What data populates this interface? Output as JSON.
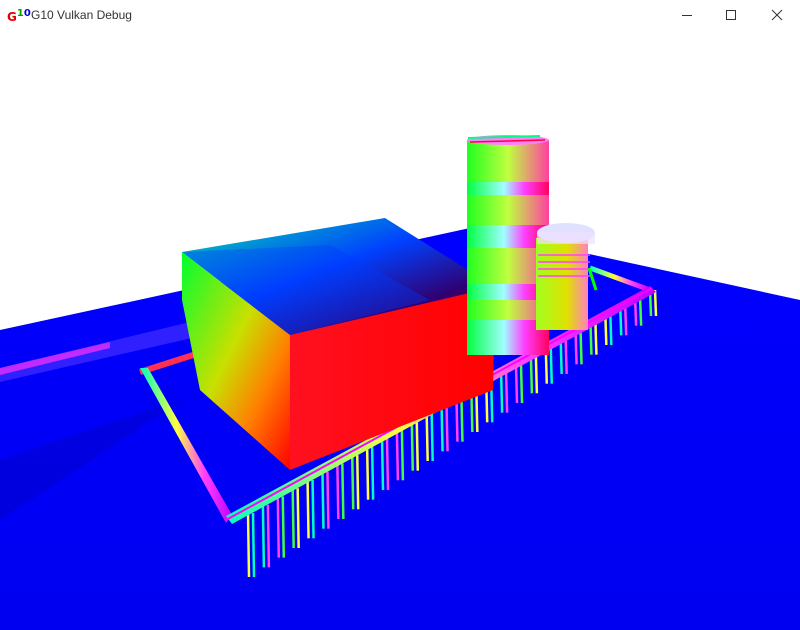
{
  "window": {
    "title": "G10 Vulkan Debug",
    "app_icon_letters": [
      "G",
      "1",
      "0"
    ],
    "app_icon_colors": [
      "#e00000",
      "#00a000",
      "#0000e0"
    ],
    "controls": {
      "minimize_icon": "minimize-icon",
      "maximize_icon": "maximize-icon",
      "close_icon": "close-icon"
    }
  },
  "scene": {
    "background_color": "#ffffff",
    "ground_color": "#0000ff",
    "objects": [
      "ground-plane",
      "large-cube",
      "cylindrical-tower",
      "small-tank",
      "pipe-rack",
      "support-columns"
    ]
  }
}
